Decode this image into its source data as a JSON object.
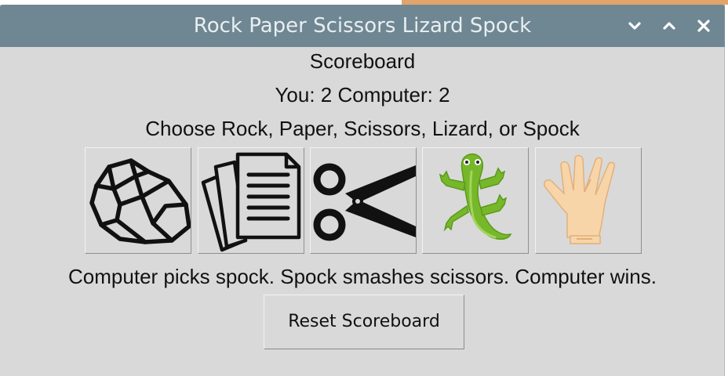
{
  "window": {
    "title": "Rock Paper Scissors Lizard Spock",
    "controls": [
      "chevron-down-icon",
      "chevron-up-icon",
      "close-icon"
    ]
  },
  "scoreboard": {
    "heading": "Scoreboard",
    "counts_text": "You:  2 Computer:  2",
    "you": 2,
    "computer": 2
  },
  "prompt": "Choose Rock, Paper, Scissors, Lizard, or Spock",
  "choices": [
    {
      "name": "rock",
      "icon": "rock-icon"
    },
    {
      "name": "paper",
      "icon": "paper-icon"
    },
    {
      "name": "scissors",
      "icon": "scissors-icon"
    },
    {
      "name": "lizard",
      "icon": "lizard-icon"
    },
    {
      "name": "spock",
      "icon": "spock-hand-icon"
    }
  ],
  "result": "Computer picks spock. Spock smashes scissors. Computer wins.",
  "reset_label": "Reset Scoreboard",
  "colors": {
    "titlebar": "#6f8793",
    "window_bg": "#d9d9d9",
    "lizard_green": "#77b82a",
    "skin": "#f7d5a8"
  }
}
